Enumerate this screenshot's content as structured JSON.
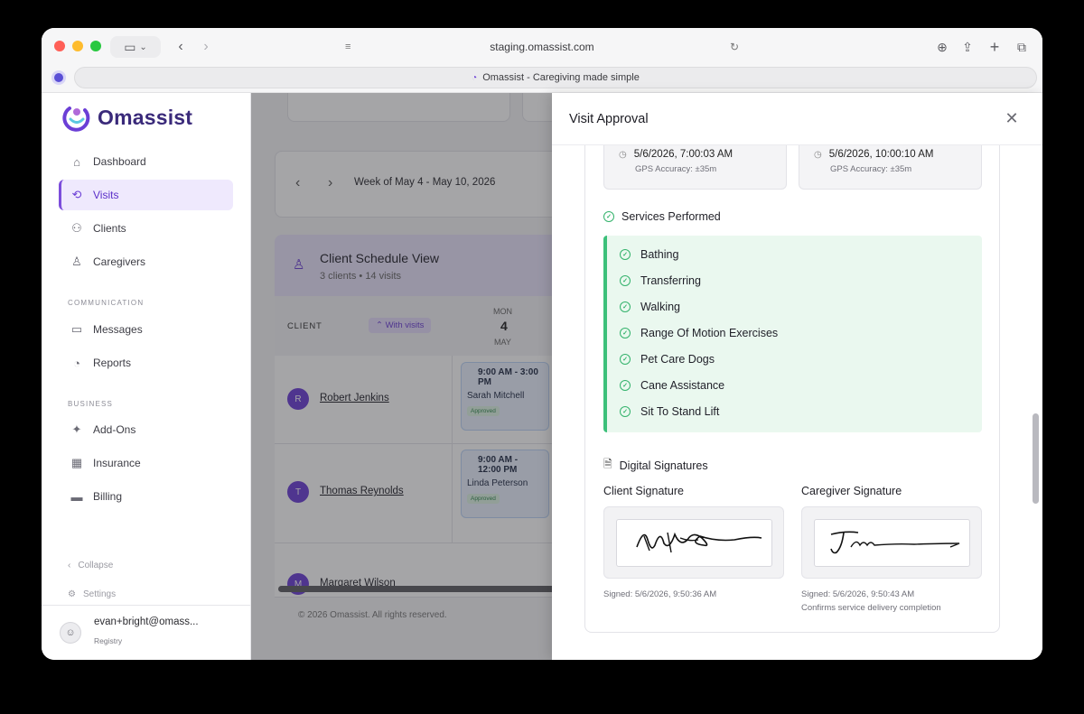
{
  "browser": {
    "url": "staging.omassist.com",
    "tab_title": "Omassist - Caregiving made simple"
  },
  "brand": {
    "name": "Omassist",
    "accent": "#7c4ddb"
  },
  "sidebar": {
    "items": [
      {
        "label": "Dashboard",
        "icon": "home-icon"
      },
      {
        "label": "Visits",
        "icon": "refresh-icon",
        "active": true
      },
      {
        "label": "Clients",
        "icon": "users-icon"
      },
      {
        "label": "Caregivers",
        "icon": "user-icon"
      }
    ],
    "communication_label": "COMMUNICATION",
    "communication_items": [
      {
        "label": "Messages",
        "icon": "inbox-icon"
      },
      {
        "label": "Reports",
        "icon": "pie-chart-icon"
      }
    ],
    "business_label": "BUSINESS",
    "business_items": [
      {
        "label": "Add-Ons",
        "icon": "sparkles-icon"
      },
      {
        "label": "Insurance",
        "icon": "building-icon"
      },
      {
        "label": "Billing",
        "icon": "credit-card-icon"
      }
    ],
    "collapse_label": "Collapse",
    "settings_label": "Settings",
    "user_email": "evan+bright@omass...",
    "user_role": "Registry"
  },
  "main": {
    "week_label": "Week of May 4 - May 10, 2026",
    "schedule_title": "Client Schedule View",
    "schedule_subtitle": "3 clients • 14 visits",
    "client_col": "CLIENT",
    "with_visits": "With visits",
    "day": {
      "dow": "MON",
      "num": "4",
      "month": "MAY"
    },
    "clients": [
      {
        "initial": "R",
        "name": "Robert Jenkins",
        "visit_time": "9:00 AM - 3:00 PM",
        "caregiver": "Sarah Mitchell",
        "status": "Approved"
      },
      {
        "initial": "T",
        "name": "Thomas Reynolds",
        "visit_time": "9:00 AM - 12:00 PM",
        "caregiver": "Linda Peterson",
        "status": "Approved"
      },
      {
        "initial": "M",
        "name": "Margaret Wilson"
      }
    ],
    "footer": "© 2026 Omassist. All rights reserved."
  },
  "drawer": {
    "title": "Visit Approval",
    "check_in": {
      "time": "5/6/2026, 7:00:03 AM",
      "accuracy": "GPS Accuracy: ±35m"
    },
    "check_out": {
      "time": "5/6/2026, 10:00:10 AM",
      "accuracy": "GPS Accuracy: ±35m"
    },
    "services_title": "Services Performed",
    "services": [
      "Bathing",
      "Transferring",
      "Walking",
      "Range Of Motion Exercises",
      "Pet Care Dogs",
      "Cane Assistance",
      "Sit To Stand Lift"
    ],
    "signatures_title": "Digital Signatures",
    "client_sig_label": "Client Signature",
    "caregiver_sig_label": "Caregiver Signature",
    "client_signed": "Signed: 5/6/2026, 9:50:36 AM",
    "caregiver_signed": "Signed: 5/6/2026, 9:50:43 AM",
    "caregiver_note": "Confirms service delivery completion"
  }
}
